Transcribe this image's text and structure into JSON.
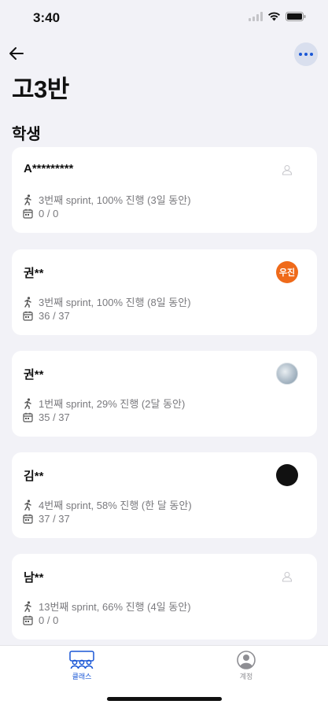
{
  "status_bar": {
    "time": "3:40"
  },
  "header": {
    "title": "고3반",
    "back_icon": "arrow-left-icon",
    "more_icon": "ellipsis-icon"
  },
  "section": {
    "title": "학생"
  },
  "students": [
    {
      "name": "A*********",
      "sprint": "3번째 sprint, 100% 진행 (3일 동안)",
      "attendance": "0 / 0",
      "avatar": {
        "type": "placeholder",
        "text": ""
      }
    },
    {
      "name": "권**",
      "sprint": "3번째 sprint, 100% 진행 (8일 동안)",
      "attendance": "36 / 37",
      "avatar": {
        "type": "initials",
        "text": "우진",
        "color": "#ef6a1a"
      }
    },
    {
      "name": "권**",
      "sprint": "1번째 sprint, 29% 진행 (2달 동안)",
      "attendance": "35 / 37",
      "avatar": {
        "type": "photo",
        "text": ""
      }
    },
    {
      "name": "김**",
      "sprint": "4번째 sprint, 58% 진행 (한 달 동안)",
      "attendance": "37 / 37",
      "avatar": {
        "type": "solid",
        "text": "",
        "color": "#111111"
      }
    },
    {
      "name": "남**",
      "sprint": "13번째 sprint, 66% 진행 (4일 동안)",
      "attendance": "0 / 0",
      "avatar": {
        "type": "placeholder",
        "text": ""
      }
    }
  ],
  "tab_bar": {
    "tabs": [
      {
        "label": "클래스",
        "icon": "class-people-icon",
        "active": true
      },
      {
        "label": "계정",
        "icon": "account-person-icon",
        "active": false
      }
    ]
  },
  "colors": {
    "accent": "#1a57d6",
    "background": "#f2f2f7",
    "secondary_text": "#7a7a7e"
  }
}
